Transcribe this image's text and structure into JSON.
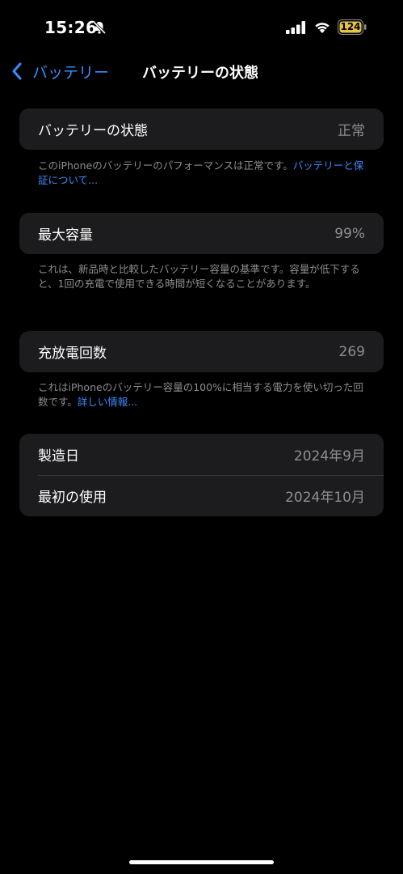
{
  "status_bar": {
    "time": "15:26",
    "battery_level": "124"
  },
  "nav": {
    "back_label": "バッテリー",
    "title": "バッテリーの状態"
  },
  "health_group": {
    "label": "バッテリーの状態",
    "value": "正常"
  },
  "health_footnote": {
    "text": "このiPhoneのバッテリーのパフォーマンスは正常です。",
    "link": "バッテリーと保証について..."
  },
  "capacity_group": {
    "label": "最大容量",
    "value": "99%"
  },
  "capacity_footnote": {
    "text": "これは、新品時と比較したバッテリー容量の基準です。容量が低下すると、1回の充電で使用できる時間が短くなることがあります。"
  },
  "cycle_group": {
    "label": "充放電回数",
    "value": "269"
  },
  "cycle_footnote": {
    "text": "これはiPhoneのバッテリー容量の100%に相当する電力を使い切った回数です。",
    "link": "詳しい情報..."
  },
  "dates_group": {
    "rows": [
      {
        "label": "製造日",
        "value": "2024年9月"
      },
      {
        "label": "最初の使用",
        "value": "2024年10月"
      }
    ]
  },
  "colors": {
    "background": "#000000",
    "group_background": "#1c1c1e",
    "accent": "#3a8dff",
    "secondary_text": "#8e8e93",
    "battery_fill": "#e6c24a"
  }
}
